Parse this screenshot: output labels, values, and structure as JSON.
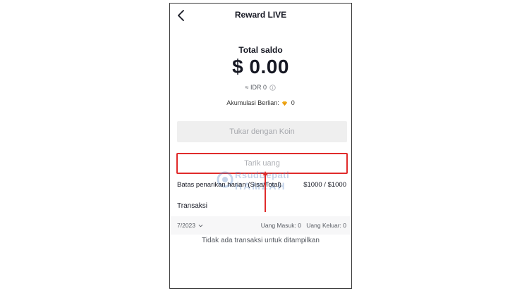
{
  "header": {
    "title": "Reward LIVE"
  },
  "balance": {
    "label": "Total saldo",
    "amount": "$ 0.00",
    "idr_text": "≈ IDR 0",
    "diamond_label": "Akumulasi Berlian:",
    "diamond_value": "0"
  },
  "actions": {
    "exchange_label": "Tukar dengan Koin",
    "withdraw_label": "Tarik uang"
  },
  "watermark": {
    "line1": "RsudDepati",
    "line2": "HAMZAH"
  },
  "limit": {
    "label": "Batas penarikan harian (Sisa/Total)",
    "value": "$1000 / $1000"
  },
  "transactions": {
    "title": "Transaksi",
    "month": "7/2023",
    "income": "Uang Masuk: 0",
    "expense": "Uang Keluar: 0",
    "empty_message": "Tidak ada transaksi untuk ditampilkan"
  },
  "colors": {
    "highlight": "#e02b2b",
    "diamond": "#f5b21b",
    "button_bg": "#efefef",
    "text_primary": "#161823"
  }
}
